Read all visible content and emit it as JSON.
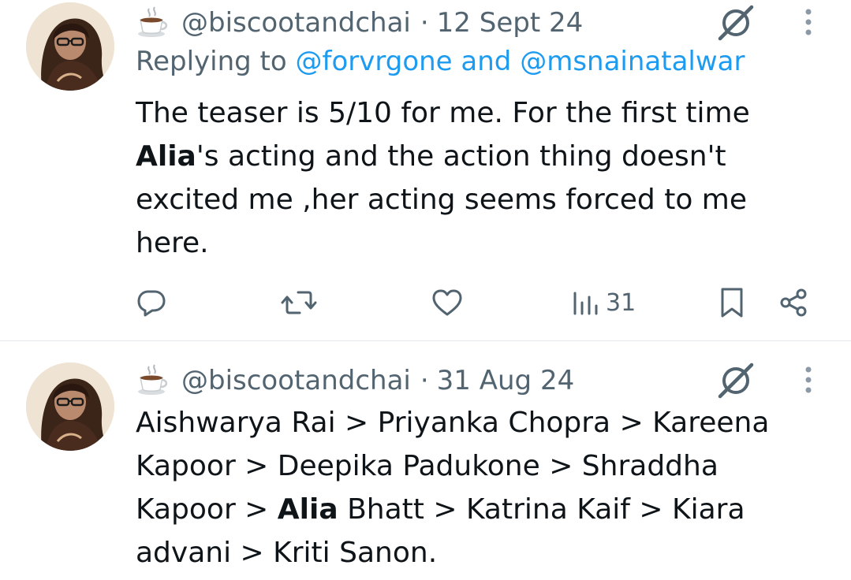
{
  "tweets": [
    {
      "emoji_icon": "coffee-cup-icon",
      "handle": "@biscootandchai",
      "separator": "·",
      "date": "12 Sept 24",
      "replying_prefix": "Replying to",
      "replying_user_1": "@forvrgone",
      "replying_and": "and",
      "replying_user_2": "@msnainatalwar",
      "body_parts": {
        "p1": "The teaser is 5/10 for me. For the first time ",
        "bold": "Alia",
        "p2": "'s acting and the action thing doesn't excited me ,her acting seems forced to me here."
      },
      "actions": {
        "reply_icon": "reply-icon",
        "repost_icon": "repost-icon",
        "like_icon": "like-icon",
        "views_icon": "views-icon",
        "views_count": "31",
        "bookmark_icon": "bookmark-icon",
        "share_icon": "share-icon"
      }
    },
    {
      "emoji_icon": "coffee-cup-icon",
      "handle": "@biscootandchai",
      "separator": "·",
      "date": "31 Aug 24",
      "body_parts": {
        "p1": "Aishwarya Rai > Priyanka Chopra > Kareena Kapoor > Deepika Padukone > Shraddha Kapoor > ",
        "bold": "Alia",
        "p2": " Bhatt > Katrina Kaif > Kiara advani > Kriti Sanon."
      }
    }
  ],
  "colors": {
    "text": "#0f1419",
    "secondary": "#536471",
    "link": "#1d9bf0",
    "divider": "#e6e9ec"
  }
}
